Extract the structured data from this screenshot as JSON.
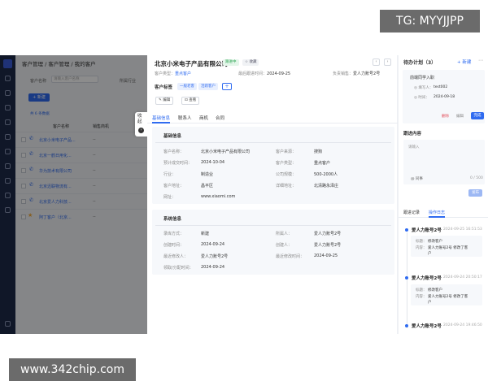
{
  "watermark_top": "TG: MYYJJPP",
  "watermark_bottom": "www.342chip.com",
  "background_list": {
    "breadcrumb": "客户管理 / 客户管理 / 我的客户",
    "filter_customer_label": "客户名称",
    "filter_customer_placeholder": "请输入客户名称",
    "filter_extra_label": "所属行业",
    "new_button": "+ 新建",
    "selected_text": "共 6 条数据",
    "col_name": "客户名称",
    "col_owner": "销售商机",
    "rows": [
      {
        "name": "北京小米电子产品...",
        "owner": "--"
      },
      {
        "name": "北京一鹤日用化...",
        "owner": "--"
      },
      {
        "name": "华为技术有限公司",
        "owner": "--"
      },
      {
        "name": "北京迅联物流有...",
        "owner": "--"
      },
      {
        "name": "北京爱人力科技...",
        "owner": "--"
      },
      {
        "name": "阿丁客户（北京...",
        "owner": "--"
      }
    ]
  },
  "collapse_tab": {
    "label": "收起",
    "arrow": "›"
  },
  "drawer": {
    "title": "北京小米电子产品有限公司",
    "status_tag": "跟进中",
    "favorite_tag": "☆ 收藏",
    "prev": "‹",
    "next": "›",
    "meta": {
      "type_label": "客户类型：",
      "type_value": "重点客户",
      "last_follow_label": "最后跟进时间：",
      "last_follow_value": "2024-09-25",
      "owner_label": "负责销售：",
      "owner_value": "爱人力账号2号"
    },
    "tag_label": "客户标签",
    "tags": [
      "一般老客",
      "活跃客户"
    ],
    "add_tag": "+",
    "actions": [
      "编辑",
      "查看"
    ],
    "tabs": [
      "基础信息",
      "联系人",
      "商机",
      "合同"
    ],
    "basic": {
      "heading": "基础信息",
      "fields": [
        {
          "k": "客户名称：",
          "v": "北京小米电子产品有限公司",
          "k2": "客户来源：",
          "v2": "搜狗"
        },
        {
          "k": "预计成交时间：",
          "v": "2024-10-04",
          "k2": "客户类型：",
          "v2": "重点客户"
        },
        {
          "k": "行业：",
          "v": "制造业",
          "k2": "公司规模：",
          "v2": "500-2000人"
        },
        {
          "k": "客户地址：",
          "v": "昌平区",
          "k2": "详细地址：",
          "v2": "北清路永泽庄"
        },
        {
          "k": "网址：",
          "v": "www.xiaomi.com",
          "k2": "",
          "v2": ""
        }
      ]
    },
    "system": {
      "heading": "系统信息",
      "fields": [
        {
          "k": "录库方式：",
          "v": "新建",
          "k2": "所属人：",
          "v2": "爱人力账号2号"
        },
        {
          "k": "创建时间：",
          "v": "2024-09-24",
          "k2": "创建人：",
          "v2": "爱人力账号2号"
        },
        {
          "k": "最近修改人：",
          "v": "爱人力账号2号",
          "k2": "最近修改时间：",
          "v2": "2024-09-25"
        },
        {
          "k": "领取/分配时间：",
          "v": "2024-09-24",
          "k2": "",
          "v2": ""
        }
      ]
    }
  },
  "right_panel": {
    "todo_heading": "待办计划（3）",
    "new_label": "+ 新建",
    "more": "⋯",
    "task": {
      "title": "前端同学入职",
      "k1": "◎ 填写人：",
      "v1": "test002",
      "k2": "◎ 时间：",
      "v2": "2024-09-18",
      "delete": "删除",
      "edit": "编辑",
      "done": "完成"
    },
    "follow_heading": "跟进内容",
    "follow_placeholder": "请输入",
    "mention": "@ 同事",
    "counter": "0 / 500",
    "publish": "发布",
    "tabs": [
      "跟进记录",
      "操作日志"
    ],
    "logs": [
      {
        "who": "爱人力账号2号",
        "time": "2024-09-25 16:51:53",
        "k1": "标题：",
        "v1": "修改客户",
        "k2": "内容：",
        "v2": "爱人力账号2号 修改了客",
        "v3": "户"
      },
      {
        "who": "爱人力账号2号",
        "time": "2024-09-24 20:50:17",
        "k1": "标题：",
        "v1": "修改客户",
        "k2": "内容：",
        "v2": "爱人力账号2号 修改了客",
        "v3": "户"
      },
      {
        "who": "爱人力账号2号",
        "time": "2024-09-24 19:46:50",
        "k1": "",
        "v1": "",
        "k2": "",
        "v2": "",
        "v3": ""
      }
    ]
  }
}
